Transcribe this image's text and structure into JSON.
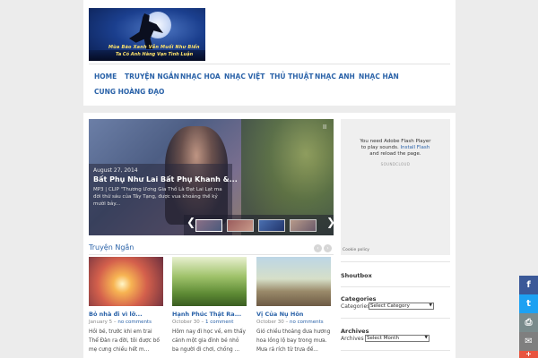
{
  "logo": {
    "line1": "Mùa Bão Xanh Vẫn Muối Như Biển",
    "line2": "Ta Có Anh Hàng Vạn Tình Luận"
  },
  "nav": {
    "items": [
      {
        "label": "HOME"
      },
      {
        "label": "TRUYỆN NGẮN"
      },
      {
        "label": "NHẠC HOA"
      },
      {
        "label": "NHẠC VIỆT"
      },
      {
        "label": "THỦ THUẬT"
      },
      {
        "label": "NHẠC ANH"
      },
      {
        "label": "NHẠC HÀN"
      },
      {
        "label": "CUNG HOÀNG ĐẠO"
      }
    ]
  },
  "slider": {
    "date": "August 27, 2014",
    "title": "Bất Phụ Như Lai Bất Phụ Khanh &...",
    "excerpt": "MP3 | CLIP \"Thương Ương Gia Thố Là Đạt Lai Lạt ma đời thứ sáu của Tây Tạng, được vua khoảng thế kỷ mười bảy...",
    "pause": "II",
    "prev": "❮",
    "next": "❯"
  },
  "section": {
    "title": "Truyện Ngắn",
    "prev": "‹",
    "next": "›"
  },
  "posts": [
    {
      "title": "Bỏ nhà đi vì lỡ...",
      "date": "January 5",
      "comments": "no comments",
      "excerpt": "Hồi bé, trước khi em trai Thể Đàn ra đời, tôi được bố mẹ cưng chiều hết m..."
    },
    {
      "title": "Hạnh Phúc Thật Ra...",
      "date": "October 30",
      "comments": "1 comment",
      "excerpt": "Hôm nay đi học về, em thấy cảnh một gia đình bé nhỏ ba người đi chơi, chồng ..."
    },
    {
      "title": "Vị Của Nụ Hôn",
      "date": "October 30",
      "comments": "no comments",
      "excerpt": "Gió chiều thoảng đưa hương hoa lồng lộ bay trong mưa. Mưa rả rích từ trưa đế..."
    }
  ],
  "sidebar": {
    "flash_line1": "You need Adobe Flash Player",
    "flash_line2": "to play sounds.",
    "flash_link": "Install Flash",
    "flash_line3": "and reload the page.",
    "soundcloud": "SOUNDCLOUD",
    "cookie": "Cookie policy",
    "shoutbox": "Shoutbox",
    "categories_title": "Categories",
    "categories_label": "Categories",
    "categories_select": "Select Category",
    "archives_title": "Archives",
    "archives_label": "Archives",
    "archives_select": "Select Month"
  },
  "share": {
    "facebook": "f",
    "twitter": "t",
    "print": "⎙",
    "email": "✉",
    "more": "+"
  },
  "colors": {
    "link": "#2a62a8",
    "facebook": "#3b5998",
    "twitter": "#1da1f2",
    "print": "#7a8b8c",
    "email": "#7f7f7f",
    "more": "#e8543f"
  }
}
